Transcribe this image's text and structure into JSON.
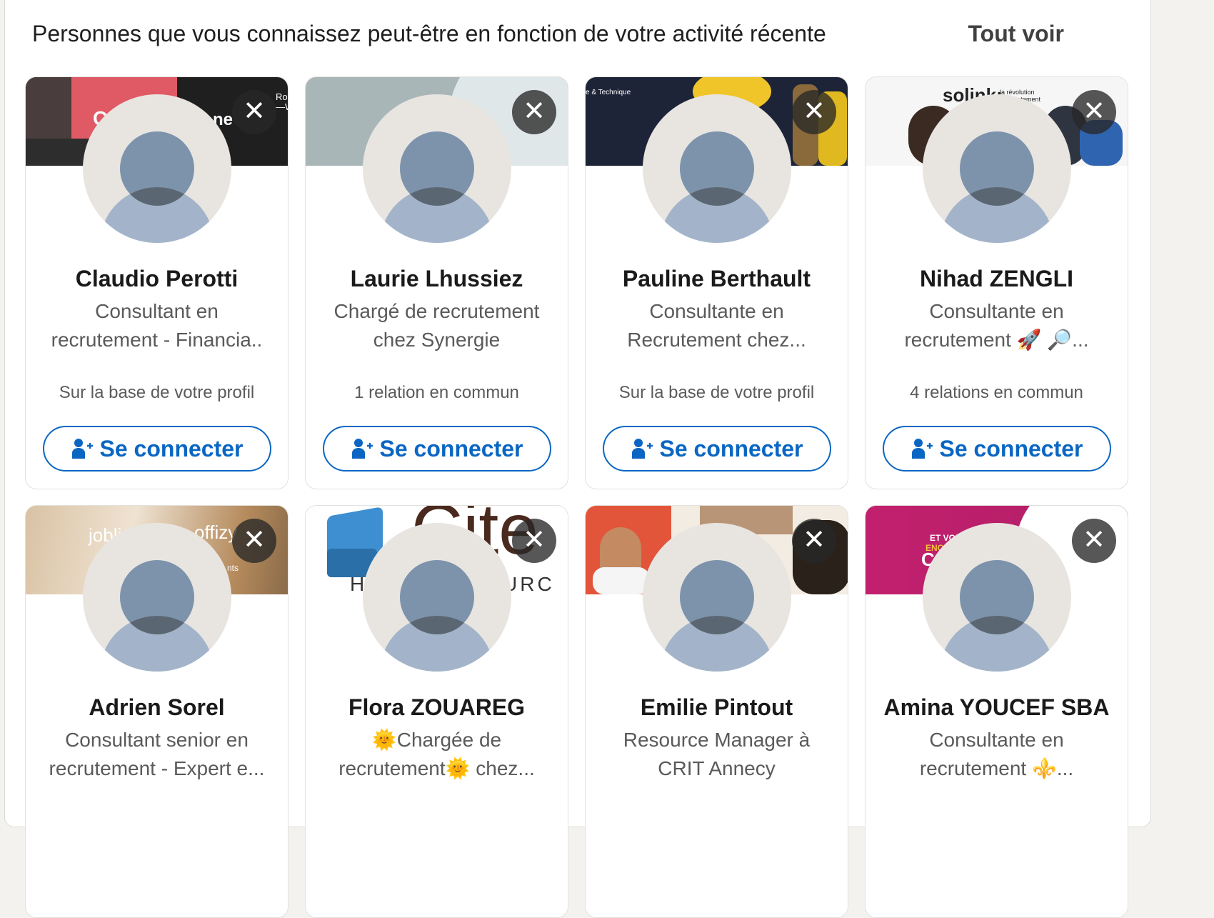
{
  "section": {
    "title": "Personnes que vous connaissez peut-être en fonction de votre activité récente",
    "see_all": "Tout voir"
  },
  "dismiss_symbol": "✕",
  "cards": [
    {
      "name": "Claudio Perotti",
      "headline_line1": "Consultant en",
      "headline_line2": "recrutement - Financia..",
      "insight": "Sur la base de votre profil",
      "connect": "Se connecter",
      "banner_text": [
        "C",
        "ne",
        "e.",
        "Rob",
        "—W"
      ]
    },
    {
      "name": "Laurie Lhussiez",
      "headline_line1": "Chargé de recrutement",
      "headline_line2": "chez Synergie",
      "insight": "1 relation en commun",
      "connect": "Se connecter"
    },
    {
      "name": "Pauline Berthault",
      "headline_line1": "Consultante en",
      "headline_line2": "Recrutement chez...",
      "insight": "Sur la base de votre profil",
      "connect": "Se connecter",
      "banner_text": [
        "e & Technique"
      ]
    },
    {
      "name": "Nihad ZENGLI",
      "headline_line1": "Consultante en",
      "headline_line2": "recrutement 🚀 🔎...",
      "insight": "4 relations en commun",
      "connect": "Se connecter",
      "banner_text": [
        "solink:",
        "la révolution",
        "...utement"
      ]
    },
    {
      "name": "Adrien Sorel",
      "headline_line1": "Consultant senior en",
      "headline_line2": "recrutement - Expert e...",
      "banner_text": [
        "jobli",
        "offizy",
        "nts"
      ]
    },
    {
      "name": "Flora ZOUAREG",
      "headline_line1": "🌞Chargée de",
      "headline_line2": "recrutement🌞 chez...",
      "banner_text": [
        "Cite",
        "H",
        "URC"
      ]
    },
    {
      "name": "Emilie Pintout",
      "headline_line1": "Resource Manager à",
      "headline_line2": "CRIT Annecy"
    },
    {
      "name": "Amina YOUCEF SBA",
      "headline_line1": "Consultante en",
      "headline_line2": "recrutement ⚜️...",
      "banner_text": [
        "ET VOU",
        "ENCOR",
        "C"
      ]
    }
  ],
  "icons": {
    "dismiss": "close-icon",
    "connect": "person-add-icon"
  }
}
